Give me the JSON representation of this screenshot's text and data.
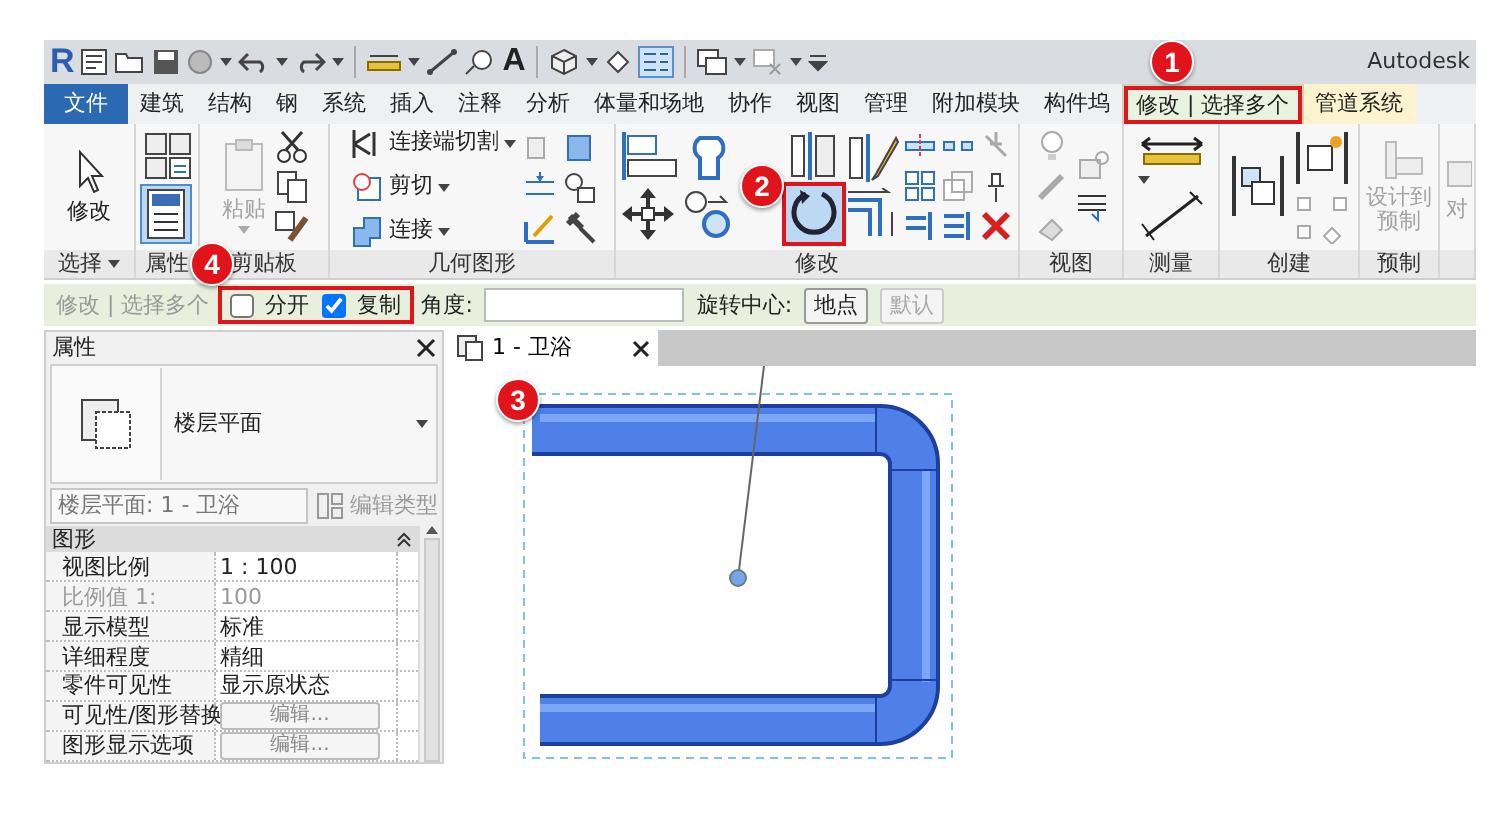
{
  "title_bar": {
    "logo": "R",
    "glyph_tool": "A",
    "app_title": "Autodesk"
  },
  "menu_tabs": [
    {
      "label": "文件",
      "kind": "file",
      "selected": false
    },
    {
      "label": "建筑",
      "kind": "tab",
      "selected": false
    },
    {
      "label": "结构",
      "kind": "tab",
      "selected": false
    },
    {
      "label": "钢",
      "kind": "tab",
      "selected": false
    },
    {
      "label": "系统",
      "kind": "tab",
      "selected": false
    },
    {
      "label": "插入",
      "kind": "tab",
      "selected": false
    },
    {
      "label": "注释",
      "kind": "tab",
      "selected": false
    },
    {
      "label": "分析",
      "kind": "tab",
      "selected": false
    },
    {
      "label": "体量和场地",
      "kind": "tab",
      "selected": false
    },
    {
      "label": "协作",
      "kind": "tab",
      "selected": false
    },
    {
      "label": "视图",
      "kind": "tab",
      "selected": false
    },
    {
      "label": "管理",
      "kind": "tab",
      "selected": false
    },
    {
      "label": "附加模块",
      "kind": "tab",
      "selected": false
    },
    {
      "label": "构件坞",
      "kind": "tab",
      "selected": false
    },
    {
      "label": "修改 | 选择多个",
      "kind": "contextual",
      "selected": true,
      "highlighted": true
    },
    {
      "label": "管道系统",
      "kind": "contextual",
      "selected": false,
      "highlighted": false
    }
  ],
  "ribbon_panels": [
    {
      "label": "选择",
      "dropdown": true,
      "tools": [
        {
          "label": "修改"
        }
      ]
    },
    {
      "label": "属性",
      "tools": [
        {
          "selected": true
        }
      ]
    },
    {
      "label": "剪贴板",
      "tools": [
        {
          "label": "粘贴",
          "disabled": true
        }
      ]
    },
    {
      "label": "几何图形",
      "tools": [
        {
          "label": "连接端切割"
        },
        {
          "label": "剪切"
        },
        {
          "label": "连接"
        }
      ]
    },
    {
      "label": "修改",
      "tools": [
        {
          "selected": true,
          "highlighted": true
        }
      ]
    },
    {
      "label": "视图"
    },
    {
      "label": "测量"
    },
    {
      "label": "创建"
    },
    {
      "label": "预制",
      "tools": [
        {
          "label": "设计到预制",
          "disabled": true
        }
      ]
    },
    {
      "tools": [
        {
          "label": "对",
          "disabled": true
        }
      ]
    }
  ],
  "options_bar": {
    "context": "修改 | 选择多个",
    "highlighted": true,
    "options": [
      {
        "label": "分开",
        "checked": false
      },
      {
        "label": "复制",
        "checked": true
      }
    ],
    "angle_label": "角度:",
    "rotation_center_label": "旋转中心:",
    "buttons": [
      {
        "label": "地点",
        "disabled": false
      },
      {
        "label": "默认",
        "disabled": true
      }
    ]
  },
  "properties": {
    "title": "属性",
    "type_name": "楼层平面",
    "instance_selector": "楼层平面: 1 - 卫浴",
    "edit_type": "编辑类型",
    "edit_type_disabled": true,
    "section": "图形",
    "rows": [
      {
        "name": "视图比例",
        "value": "1 : 100",
        "kind": "text",
        "disabled": false
      },
      {
        "name": "比例值 1:",
        "value": "100",
        "kind": "text",
        "disabled": true
      },
      {
        "name": "显示模型",
        "value": "标准",
        "kind": "text",
        "disabled": false
      },
      {
        "name": "详细程度",
        "value": "精细",
        "kind": "text",
        "disabled": false
      },
      {
        "name": "零件可见性",
        "value": "显示原状态",
        "kind": "text",
        "disabled": false
      },
      {
        "name": "可见性/图形替换",
        "value": "编辑...",
        "kind": "button",
        "disabled": false
      },
      {
        "name": "图形显示选项",
        "value": "编辑...",
        "kind": "button",
        "disabled": false
      }
    ]
  },
  "view": {
    "tab_label": "1 - 卫浴"
  },
  "callouts": [
    {
      "number": "1"
    },
    {
      "number": "2"
    },
    {
      "number": "3"
    },
    {
      "number": "4"
    }
  ]
}
